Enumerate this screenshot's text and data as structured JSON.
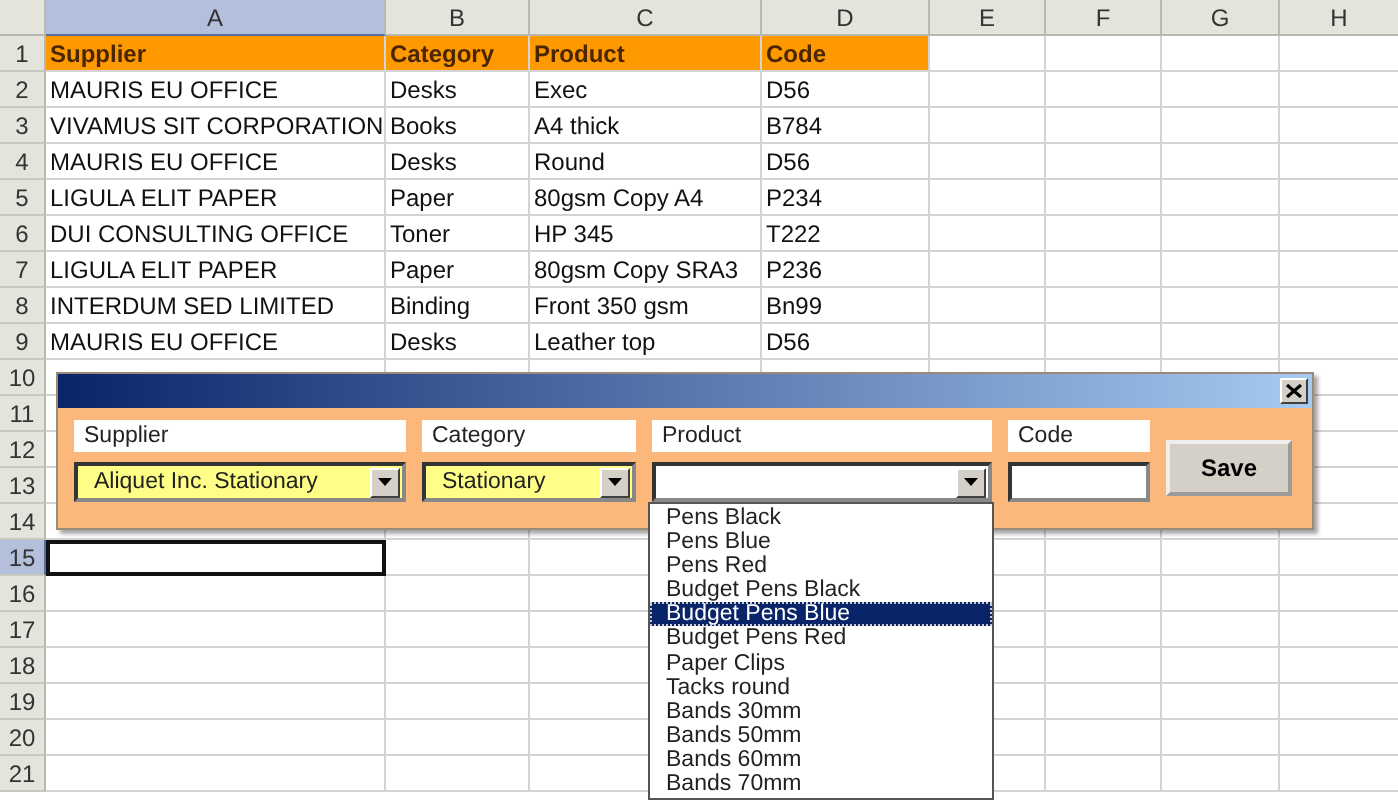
{
  "sheet": {
    "columns": [
      {
        "label": "A",
        "selected": true
      },
      {
        "label": "B",
        "selected": false
      },
      {
        "label": "C",
        "selected": false
      },
      {
        "label": "D",
        "selected": false
      },
      {
        "label": "E",
        "selected": false
      },
      {
        "label": "F",
        "selected": false
      },
      {
        "label": "G",
        "selected": false
      },
      {
        "label": "H",
        "selected": false
      }
    ],
    "rows": [
      {
        "number": "1",
        "kind": "header",
        "selected": false,
        "cells": [
          "Supplier",
          "Category",
          "Product",
          "Code"
        ]
      },
      {
        "number": "2",
        "kind": "data",
        "selected": false,
        "cells": [
          "MAURIS EU OFFICE",
          "Desks",
          "Exec",
          "D56"
        ]
      },
      {
        "number": "3",
        "kind": "data",
        "selected": false,
        "cells": [
          "VIVAMUS SIT CORPORATION",
          "Books",
          "A4 thick",
          "B784"
        ]
      },
      {
        "number": "4",
        "kind": "data",
        "selected": false,
        "cells": [
          "MAURIS EU OFFICE",
          "Desks",
          "Round",
          "D56"
        ]
      },
      {
        "number": "5",
        "kind": "data",
        "selected": false,
        "cells": [
          "LIGULA ELIT PAPER",
          "Paper",
          "80gsm Copy A4",
          "P234"
        ]
      },
      {
        "number": "6",
        "kind": "data",
        "selected": false,
        "cells": [
          "DUI CONSULTING OFFICE",
          "Toner",
          "HP 345",
          "T222"
        ]
      },
      {
        "number": "7",
        "kind": "data",
        "selected": false,
        "cells": [
          "LIGULA ELIT PAPER",
          "Paper",
          "80gsm Copy SRA3",
          "P236"
        ]
      },
      {
        "number": "8",
        "kind": "data",
        "selected": false,
        "cells": [
          "INTERDUM SED LIMITED",
          "Binding",
          "Front 350 gsm",
          "Bn99"
        ]
      },
      {
        "number": "9",
        "kind": "data",
        "selected": false,
        "cells": [
          "MAURIS EU OFFICE",
          "Desks",
          "Leather top",
          "D56"
        ]
      },
      {
        "number": "10",
        "kind": "data",
        "selected": false,
        "cells": []
      },
      {
        "number": "11",
        "kind": "data",
        "selected": false,
        "cells": []
      },
      {
        "number": "12",
        "kind": "data",
        "selected": false,
        "cells": []
      },
      {
        "number": "13",
        "kind": "data",
        "selected": false,
        "cells": []
      },
      {
        "number": "14",
        "kind": "data",
        "selected": false,
        "cells": []
      },
      {
        "number": "15",
        "kind": "data",
        "selected": true,
        "cells": []
      },
      {
        "number": "16",
        "kind": "data",
        "selected": false,
        "cells": []
      },
      {
        "number": "17",
        "kind": "data",
        "selected": false,
        "cells": []
      },
      {
        "number": "18",
        "kind": "data",
        "selected": false,
        "cells": []
      },
      {
        "number": "19",
        "kind": "data",
        "selected": false,
        "cells": []
      },
      {
        "number": "20",
        "kind": "data",
        "selected": false,
        "cells": []
      },
      {
        "number": "21",
        "kind": "data",
        "selected": false,
        "cells": []
      }
    ]
  },
  "dialog": {
    "fields": [
      {
        "label": "Supplier",
        "kind": "combo",
        "value": "Aliquet Inc. Stationary"
      },
      {
        "label": "Category",
        "kind": "combo",
        "value": "Stationary"
      },
      {
        "label": "Product",
        "kind": "combo",
        "expanded": true,
        "options": [
          {
            "label": "Pens Black",
            "selected": false
          },
          {
            "label": "Pens Blue",
            "selected": false
          },
          {
            "label": "Pens Red",
            "selected": false
          },
          {
            "label": "Budget Pens Black",
            "selected": false
          },
          {
            "label": "Budget Pens Blue",
            "selected": true
          },
          {
            "label": "Budget Pens Red",
            "selected": false
          },
          {
            "label": "Paper Clips",
            "selected": false
          },
          {
            "label": "Tacks round",
            "selected": false
          },
          {
            "label": "Bands 30mm",
            "selected": false
          },
          {
            "label": "Bands 50mm",
            "selected": false
          },
          {
            "label": "Bands 60mm",
            "selected": false
          },
          {
            "label": "Bands 70mm",
            "selected": false
          }
        ]
      },
      {
        "label": "Code",
        "kind": "text"
      }
    ],
    "button": "Save"
  }
}
